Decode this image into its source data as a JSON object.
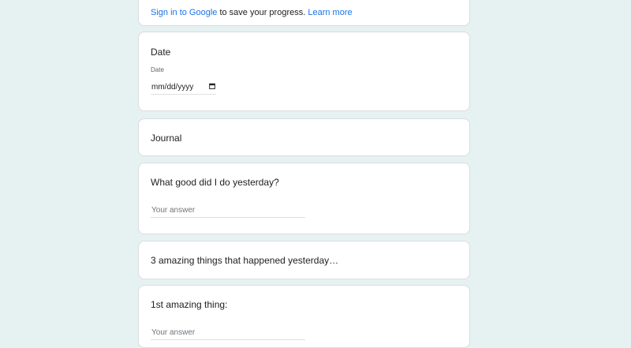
{
  "signin": {
    "link_text": "Sign in to Google",
    "middle_text": " to save your progress. ",
    "learn_more": "Learn more"
  },
  "questions": {
    "date": {
      "title": "Date",
      "field_label": "Date",
      "placeholder": "mm/dd/yyyy",
      "icon": "calendar-icon"
    },
    "journal": {
      "title": "Journal"
    },
    "good": {
      "title": "What good did I do yesterday?",
      "answer_placeholder": "Your answer"
    },
    "amazing": {
      "title": "3 amazing things that happened yesterday…"
    },
    "first": {
      "title": "1st amazing thing:",
      "answer_placeholder": "Your answer"
    }
  },
  "colors": {
    "background": "#e6f1f2",
    "link": "#1a73e8",
    "card": "#ffffff"
  }
}
